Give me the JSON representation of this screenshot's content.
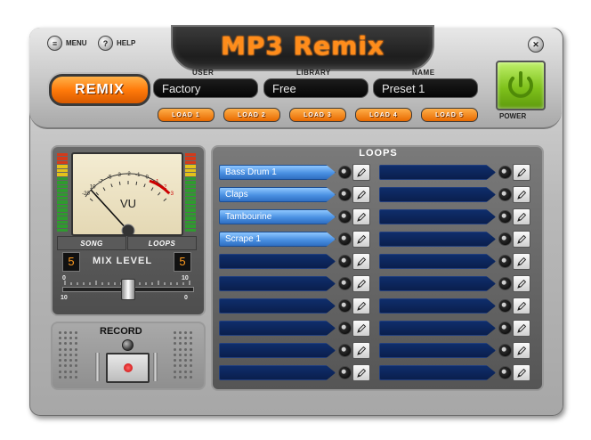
{
  "app": {
    "title": "MP3 Remix",
    "menu_label": "MENU",
    "help_label": "HELP",
    "remix_label": "REMIX",
    "power_label": "POWER"
  },
  "fields": {
    "user_label": "USER",
    "user_value": "Factory",
    "library_label": "LIBRARY",
    "library_value": "Free",
    "name_label": "NAME",
    "name_value": "Preset 1"
  },
  "load_buttons": [
    "LOAD 1",
    "LOAD 2",
    "LOAD 3",
    "LOAD 4",
    "LOAD 5"
  ],
  "meter": {
    "vu_label": "VU",
    "scale_labels": [
      "-20",
      "10",
      "-7",
      "-5",
      "-3",
      "-2",
      "-1",
      "0",
      "+1",
      "+2",
      "+3"
    ],
    "song_label": "SONG",
    "loops_label": "LOOPS",
    "song_count": "5",
    "loops_count": "5",
    "mix_label": "MIX LEVEL",
    "mix_left_top": "0",
    "mix_left_bottom": "10",
    "mix_right_top": "10",
    "mix_right_bottom": "0",
    "mix_level_fraction": 0.5
  },
  "record": {
    "label": "RECORD"
  },
  "loops": {
    "title": "LOOPS",
    "left_column": [
      "Bass Drum 1",
      "Claps",
      "Tambourine",
      "Scrape 1",
      "",
      "",
      "",
      "",
      "",
      ""
    ],
    "right_column": [
      "",
      "",
      "",
      "",
      "",
      "",
      "",
      "",
      "",
      ""
    ]
  },
  "colors": {
    "accent_orange": "#ff7a0a",
    "power_green": "#7fc21c",
    "slot_filled": "#4a90e2",
    "slot_empty": "#0f2e6b"
  }
}
